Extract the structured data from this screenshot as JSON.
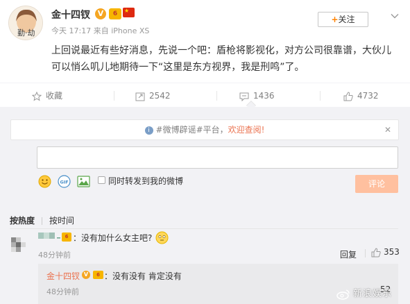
{
  "post": {
    "author": "金十四钗",
    "verified_badge": "V",
    "level_badge": "6",
    "time": "今天 17:17",
    "source_prefix": "来自",
    "source": "iPhone XS",
    "follow_plus": "+",
    "follow_label": "关注",
    "text": "上回说最近有些好消息，先说一个吧：盾枪将影视化，对方公司很靠谱，大伙儿可以悄么叽儿地期待一下“这里是东方视界，我是刑鸣”了。"
  },
  "actions": {
    "favorite": "收藏",
    "repost": "2542",
    "comment": "1436",
    "like": "4732"
  },
  "notice": {
    "hashtag1": "#微博辟谣#",
    "hashtag2": "平台，",
    "link": "欢迎查阅!",
    "close": "✕"
  },
  "composer": {
    "repost_label": "同时转发到我的微博",
    "submit_label": "评论"
  },
  "sort": {
    "hot": "按热度",
    "time": "按时间"
  },
  "comments": [
    {
      "badge": "6",
      "suffix": "_",
      "text": "：没有加什么女主吧?",
      "time": "48分钟前",
      "reply_label": "回复",
      "likes": "353"
    }
  ],
  "reply": {
    "author": "金十四钗",
    "verified_badge": "V",
    "level_badge": "6",
    "text": "：没有没有 肯定没有",
    "time": "48分钟前",
    "likes": "52"
  },
  "watermark": "新浪娱乐",
  "colors": {
    "accent": "#ff8200",
    "link": "#eb7350",
    "submit_disabled": "#ffc09f",
    "comment_bg": "#f2f2f5"
  }
}
